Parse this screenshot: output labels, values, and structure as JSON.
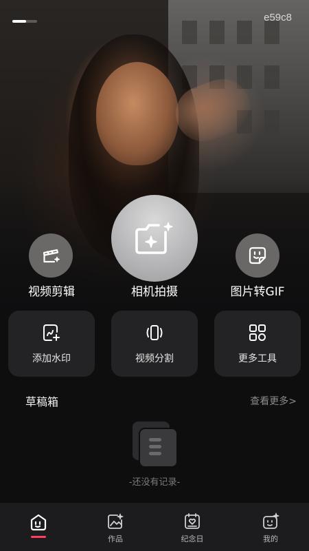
{
  "status": {
    "code": "e59c8",
    "progress": 0.55
  },
  "actions": {
    "video_edit": "视频剪辑",
    "camera": "相机拍摄",
    "gif": "图片转GIF"
  },
  "tools": [
    {
      "label": "添加水印",
      "icon": "add-watermark-icon"
    },
    {
      "label": "视频分割",
      "icon": "video-split-icon"
    },
    {
      "label": "更多工具",
      "icon": "more-tools-icon"
    }
  ],
  "drafts": {
    "title": "草稿箱",
    "more": "查看更多>",
    "empty": "-还没有记录-"
  },
  "tabs": [
    {
      "label": "",
      "icon": "home-icon",
      "active": true
    },
    {
      "label": "作品",
      "icon": "works-icon"
    },
    {
      "label": "纪念日",
      "icon": "anniversary-icon"
    },
    {
      "label": "我的",
      "icon": "profile-icon"
    }
  ],
  "colors": {
    "accent": "#ff3f5d",
    "card": "#232325",
    "tabbar": "#1c1c1e"
  }
}
